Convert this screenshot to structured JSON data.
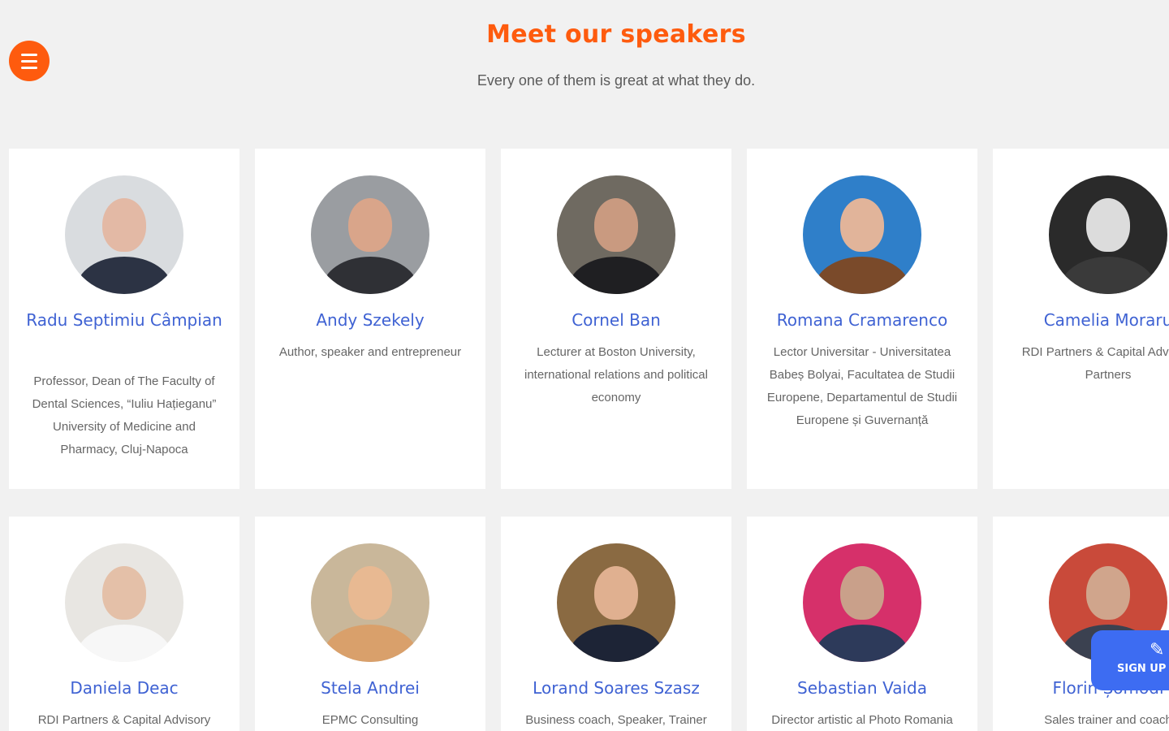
{
  "header": {
    "title": "Meet our speakers",
    "subtitle": "Every one of them is great at what they do."
  },
  "menu": {
    "icon": "hamburger-menu-icon"
  },
  "speakers": [
    {
      "name": "Radu Septimiu Câmpian",
      "role": "Professor, Dean of The Faculty of Dental Sciences, “Iuliu Hațieganu” University of Medicine and Pharmacy, Cluj-Napoca"
    },
    {
      "name": "Andy Szekely",
      "role": "Author, speaker and entrepreneur"
    },
    {
      "name": "Cornel Ban",
      "role": "Lecturer at Boston University, international relations and political economy"
    },
    {
      "name": "Romana Cramarenco",
      "role": "Lector Universitar - Universitatea Babeș Bolyai, Facultatea de Studii Europene, Departamentul de Studii Europene și Guvernanță"
    },
    {
      "name": "Camelia Moraru",
      "role": "RDI Partners & Capital Advisory Partners"
    },
    {
      "name": "Daniela Deac",
      "role": "RDI Partners & Capital Advisory"
    },
    {
      "name": "Stela Andrei",
      "role": "EPMC Consulting"
    },
    {
      "name": "Lorand Soares Szasz",
      "role": "Business coach, Speaker, Trainer"
    },
    {
      "name": "Sebastian Vaida",
      "role": "Director artistic al Photo Romania"
    },
    {
      "name": "Florin Șomodi",
      "role": "Sales trainer and coach"
    }
  ],
  "signup": {
    "label": "SIGN UP NOW",
    "icon": "pencil-icon"
  },
  "colors": {
    "accent": "#fe5b0e",
    "name": "#3f62d3",
    "signup": "#3d6cf2"
  }
}
